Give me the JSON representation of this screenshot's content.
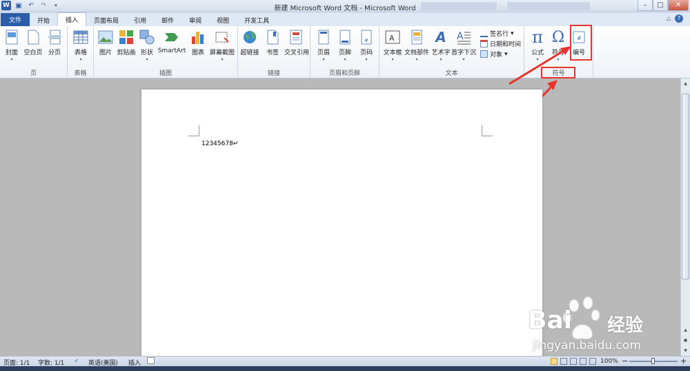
{
  "window": {
    "title": "新建 Microsoft Word 文档 - Microsoft Word",
    "minimize": "–",
    "maximize": "□",
    "close": "✕"
  },
  "qat": {
    "logo": "W",
    "save": "💾",
    "undo": "↶",
    "redo": "↷"
  },
  "tabs": [
    "文件",
    "开始",
    "插入",
    "页面布局",
    "引用",
    "邮件",
    "审阅",
    "视图",
    "开发工具"
  ],
  "help_icon": "?",
  "ribbon_min": "△",
  "ribbon": {
    "groups": {
      "page": "页",
      "table": "表格",
      "illustration": "插图",
      "links": "链接",
      "header_footer": "页眉和页脚",
      "text": "文本",
      "symbols": "符号"
    },
    "buttons": {
      "cover": "封面",
      "blank_page": "空白页",
      "page_break": "分页",
      "table": "表格",
      "picture": "图片",
      "clipart": "剪贴画",
      "shapes": "形状",
      "smartart": "SmartArt",
      "chart": "图表",
      "screenshot": "屏幕截图",
      "hyperlink": "超链接",
      "bookmark": "书签",
      "cross_ref": "交叉引用",
      "header": "页眉",
      "footer": "页脚",
      "page_number": "页码",
      "textbox": "文本框",
      "quickparts": "文档部件",
      "wordart": "艺术字",
      "dropcap": "首字下沉",
      "signature": "签名行",
      "datetime": "日期和时间",
      "object": "对象",
      "equation": "公式",
      "symbol": "符号",
      "number": "编号"
    },
    "glyphs": {
      "pi": "π",
      "omega": "Ω",
      "dropdown": "▾",
      "wordart_a": "A",
      "number_hash": "#"
    }
  },
  "document": {
    "text": "12345678↵"
  },
  "statusbar": {
    "page": "页面: 1/1",
    "words": "字数: 1/1",
    "language": "英语(美国)",
    "mode": "插入",
    "zoom": "100%",
    "zoom_minus": "−",
    "zoom_plus": "+"
  },
  "watermark": {
    "brand": "Bai",
    "brand_cn": "经验",
    "url": "jingyan.baidu.com"
  },
  "colors": {
    "accent": "#2a5caa",
    "annotation": "#e8322b"
  }
}
